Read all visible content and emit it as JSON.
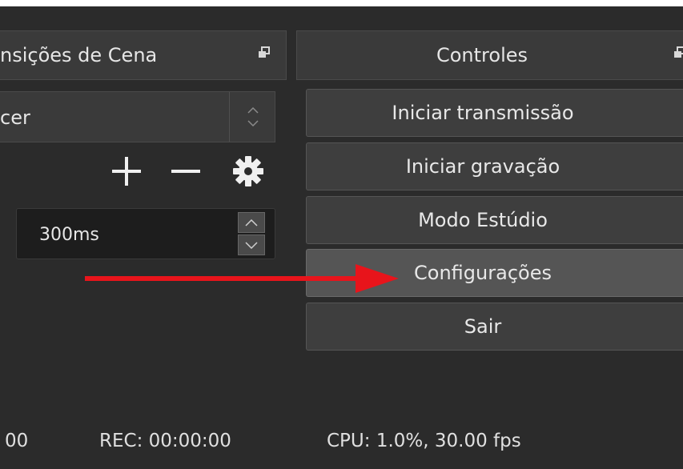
{
  "transitions_dock": {
    "title": "nsições de Cena"
  },
  "controls_dock": {
    "title": "Controles"
  },
  "transition_select": {
    "value": "cer"
  },
  "transition_duration": {
    "value": "300ms"
  },
  "controls": {
    "buttons": [
      {
        "label": "Iniciar transmissão"
      },
      {
        "label": "Iniciar gravação"
      },
      {
        "label": "Modo Estúdio"
      },
      {
        "label": "Configurações",
        "highlighted": true
      },
      {
        "label": "Sair"
      }
    ]
  },
  "status_bar": {
    "live_time_partial": "00",
    "rec": "REC: 00:00:00",
    "cpu": "CPU: 1.0%, 30.00 fps"
  },
  "annotation": {
    "color": "#e8141b",
    "icon": "red-arrow-pointing-right"
  }
}
